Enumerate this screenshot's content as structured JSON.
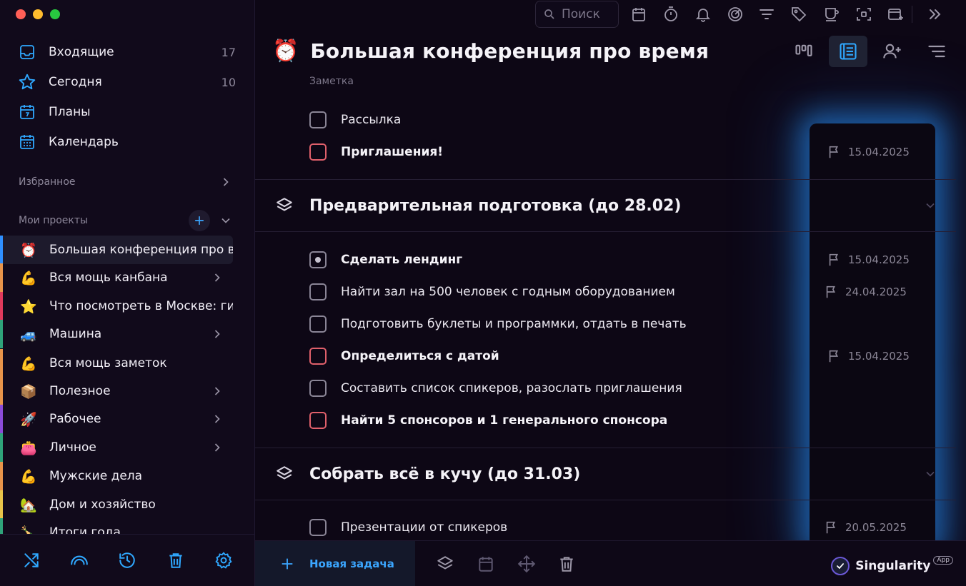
{
  "colors": {
    "accent": "#2fa8ff",
    "sidebar_bg": "#110a1b",
    "main_bg": "#0d0715",
    "important": "#e0606b",
    "glow": "#2896ff"
  },
  "window": {
    "traffic_lights": [
      "#ff5f57",
      "#febc2e",
      "#28c840"
    ]
  },
  "sidebar": {
    "nav": [
      {
        "label": "Входящие",
        "count": "17",
        "icon": "inbox-icon"
      },
      {
        "label": "Сегодня",
        "count": "10",
        "icon": "star-icon"
      },
      {
        "label": "Планы",
        "count": "",
        "icon": "calendar-day-icon"
      },
      {
        "label": "Календарь",
        "count": "",
        "icon": "calendar-grid-icon"
      }
    ],
    "favorites_label": "Избранное",
    "projects_label": "Мои проекты",
    "projects": [
      {
        "emoji": "⏰",
        "label": "Большая конференция про время",
        "color": "#2f8fff",
        "has_children": false,
        "active": true
      },
      {
        "emoji": "💪",
        "label": "Вся мощь канбана",
        "color": "#e8944a",
        "has_children": true
      },
      {
        "emoji": "⭐",
        "label": "Что посмотреть в Москве: гид",
        "color": "#e03a5c",
        "has_children": false
      },
      {
        "emoji": "🚙",
        "label": "Машина",
        "color": "#2fa37a",
        "has_children": true
      },
      {
        "emoji": "💪",
        "label": "Вся мощь заметок",
        "color": "#e8944a",
        "has_children": false
      },
      {
        "emoji": "📦",
        "label": "Полезное",
        "color": "#e8944a",
        "has_children": true
      },
      {
        "emoji": "🚀",
        "label": "Рабочее",
        "color": "#8b4bd8",
        "has_children": true
      },
      {
        "emoji": "👛",
        "label": "Личное",
        "color": "#2fa37a",
        "has_children": true
      },
      {
        "emoji": "💪",
        "label": "Мужские дела",
        "color": "#e8944a",
        "has_children": false
      },
      {
        "emoji": "🏡",
        "label": "Дом и хозяйство",
        "color": "#e8c44a",
        "has_children": false
      },
      {
        "emoji": "🍾",
        "label": "Итоги года",
        "color": "#2fa37a",
        "has_children": false
      }
    ],
    "bottom_icons": [
      "shuffle-icon",
      "rainbow-icon",
      "history-icon",
      "trash-icon",
      "gear-icon"
    ]
  },
  "toolbar": {
    "search_placeholder": "Поиск",
    "icons": [
      "calendar-icon",
      "timer-icon",
      "bell-icon",
      "focus-icon",
      "filter-icon",
      "tag-icon",
      "cup-icon",
      "scan-icon",
      "window-add-icon",
      "collapse-right-icon"
    ]
  },
  "project": {
    "emoji": "⏰",
    "title": "Большая конференция про время",
    "note_label": "Заметка",
    "view_icons": [
      "kanban-icon",
      "list-view-icon",
      "assign-user-icon",
      "sort-icon"
    ],
    "top_tasks": [
      {
        "text": "Рассылка",
        "bold": false,
        "important": false,
        "due": ""
      },
      {
        "text": "Приглашения!",
        "bold": true,
        "important": true,
        "due": "15.04.2025"
      }
    ],
    "groups": [
      {
        "title": "Предварительная подготовка (до 28.02)",
        "tasks": [
          {
            "text": "Сделать лендинг",
            "bold": true,
            "important": false,
            "in_progress": true,
            "due": "15.04.2025"
          },
          {
            "text": "Найти зал на 500 человек с годным оборудованием",
            "bold": false,
            "important": false,
            "due": "24.04.2025"
          },
          {
            "text": "Подготовить буклеты и программки, отдать в печать",
            "bold": false,
            "important": false,
            "due": ""
          },
          {
            "text": "Определиться с датой",
            "bold": true,
            "important": true,
            "due": "15.04.2025"
          },
          {
            "text": "Составить список спикеров, разослать приглашения",
            "bold": false,
            "important": false,
            "due": ""
          },
          {
            "text": "Найти 5 спонсоров и 1 генерального спонсора",
            "bold": true,
            "important": true,
            "due": ""
          }
        ]
      },
      {
        "title": "Собрать всё в кучу (до 31.03)",
        "tasks": [
          {
            "text": "Презентации от спикеров",
            "bold": false,
            "important": false,
            "due": "20.05.2025"
          }
        ]
      }
    ]
  },
  "bottom": {
    "new_task_label": "Новая задача",
    "icons": [
      "layers-icon",
      "calendar-icon",
      "move-icon",
      "trash-icon"
    ],
    "brand_name": "Singularity",
    "brand_badge": "App"
  }
}
